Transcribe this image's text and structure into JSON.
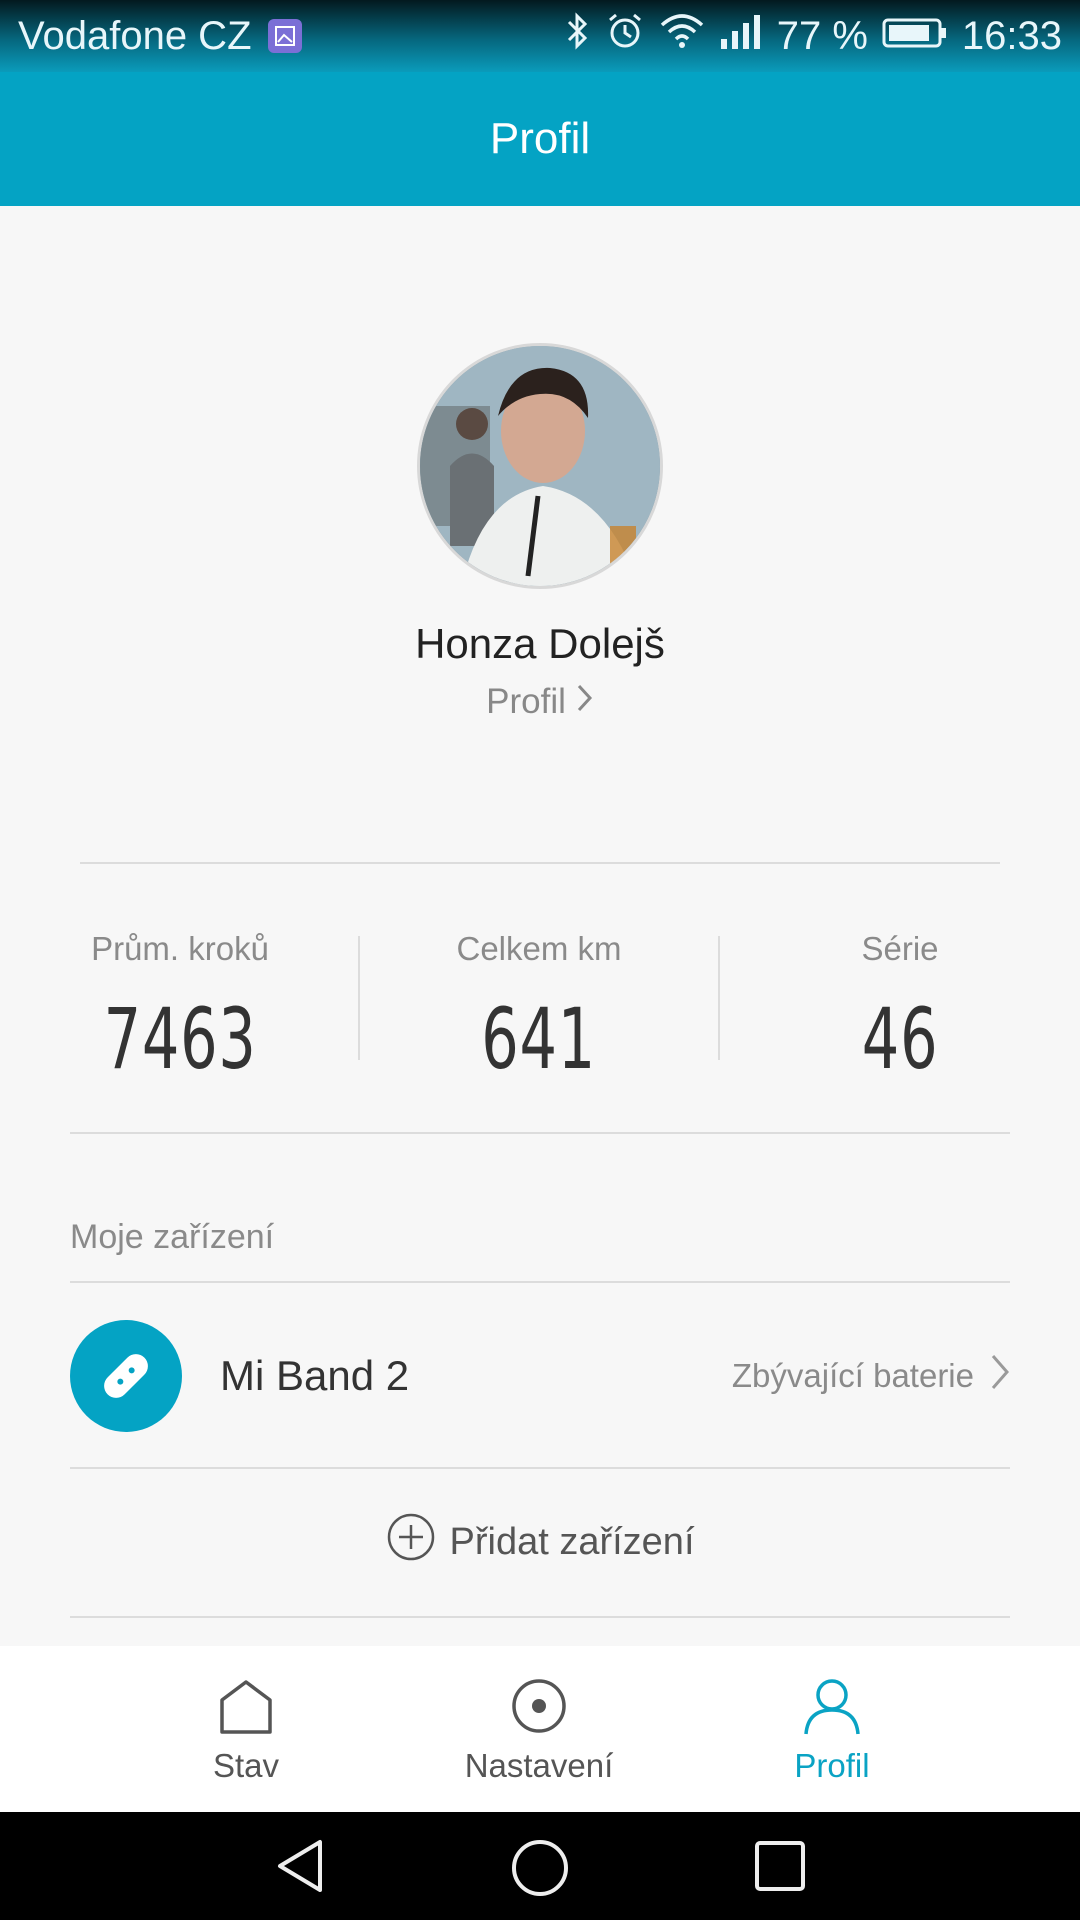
{
  "status_bar": {
    "carrier": "Vodafone CZ",
    "battery_text": "77 %",
    "time": "16:33",
    "icons": [
      "image-notification-icon",
      "bluetooth-icon",
      "alarm-icon",
      "wifi-icon",
      "signal-icon",
      "battery-icon"
    ]
  },
  "app_bar": {
    "title": "Profil"
  },
  "profile": {
    "name": "Honza Dolejš",
    "link_label": "Profil"
  },
  "stats": [
    {
      "label": "Prům. kroků",
      "value": "7463"
    },
    {
      "label": "Celkem km",
      "value": "641"
    },
    {
      "label": "Série",
      "value": "46"
    }
  ],
  "devices": {
    "section_title": "Moje zařízení",
    "items": [
      {
        "name": "Mi Band 2",
        "status": "Zbývající baterie",
        "icon": "band-icon"
      }
    ],
    "add_label": "Přidat zařízení"
  },
  "bottom_nav": {
    "items": [
      {
        "label": "Stav",
        "icon": "home-icon",
        "active": false
      },
      {
        "label": "Nastavení",
        "icon": "settings-circle-icon",
        "active": false
      },
      {
        "label": "Profil",
        "icon": "person-icon",
        "active": true
      }
    ]
  },
  "colors": {
    "accent": "#04a3c4",
    "background": "#f7f7f7",
    "text_primary": "#333333",
    "text_secondary": "#8a8a8a"
  }
}
